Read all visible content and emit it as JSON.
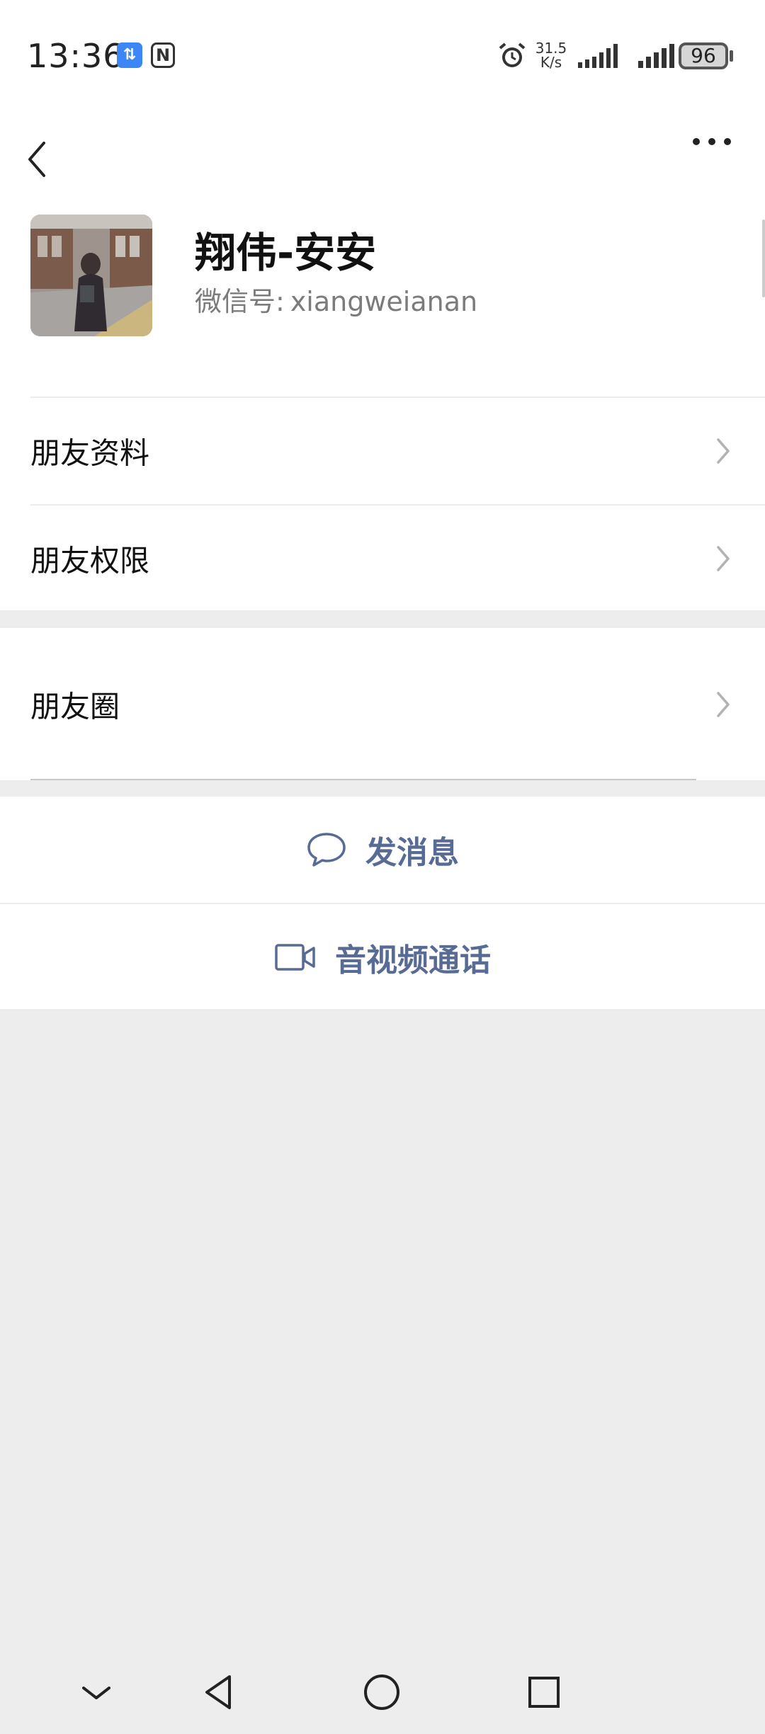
{
  "status_bar": {
    "time": "13:36",
    "data_badge": "⇅",
    "nfc": "N",
    "network_speed_value": "31.5",
    "network_speed_unit": "K/s",
    "battery": "96"
  },
  "profile": {
    "name": "翔伟-安安",
    "wechat_id_label": "微信号:",
    "wechat_id": "xiangweianan"
  },
  "menu": {
    "friend_info": "朋友资料",
    "friend_permissions": "朋友权限",
    "moments": "朋友圈"
  },
  "actions": {
    "send_message": "发消息",
    "audio_video_call": "音视频通话"
  },
  "colors": {
    "accent": "#576b95",
    "background": "#ededed",
    "surface": "#ffffff"
  },
  "icons": {
    "back": "chevron-left-icon",
    "more": "more-dots-icon",
    "chat": "chat-bubble-icon",
    "video": "video-camera-icon"
  }
}
